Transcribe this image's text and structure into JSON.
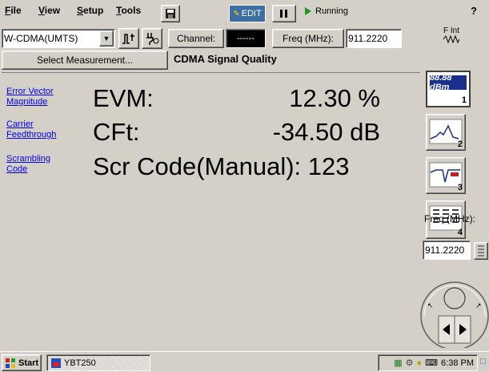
{
  "menubar": {
    "file": "File",
    "view": "View",
    "setup": "Setup",
    "tools": "Tools",
    "edit_label": "EDIT",
    "run_status": "Running",
    "help": "?"
  },
  "controls": {
    "standard": "W-CDMA(UMTS)",
    "channel_label": "Channel:",
    "channel_value": "------",
    "freq_label": "Freq (MHz):",
    "freq_value": "911.2220",
    "fint_label": "F Int"
  },
  "measurement": {
    "select_label": "Select Measurement...",
    "title": "CDMA Signal Quality"
  },
  "links": {
    "evm": [
      "Error Vector",
      "Magnitude"
    ],
    "cft": [
      "Carrier",
      "Feedthrough"
    ],
    "scr": [
      "Scrambling",
      "Code"
    ]
  },
  "readings": {
    "evm_label": "EVM:",
    "evm_value": "12.30 %",
    "cft_label": "CFt:",
    "cft_value": "-34.50 dB",
    "scr_label": "Scr Code(Manual): 123"
  },
  "right_panel": {
    "unit_display": "88.88 dBm",
    "btn1_num": "1",
    "btn2_num": "2",
    "btn3_num": "3",
    "btn4_num": "4",
    "rf_label": "Freq (MHz):",
    "rf_value": "911.2220"
  },
  "taskbar": {
    "start": "Start",
    "task": "YBT250",
    "clock": "6:38 PM"
  },
  "colors": {
    "link": "#0000ee",
    "edit_bg": "#3a6ea5",
    "unit_bg": "#1a2f8a"
  }
}
